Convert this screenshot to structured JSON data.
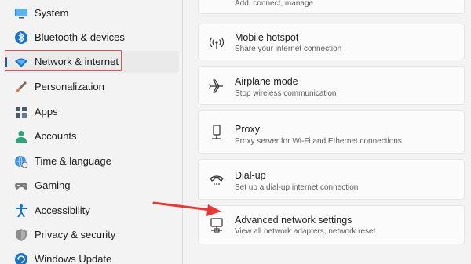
{
  "sidebar": {
    "items": [
      {
        "label": "System",
        "icon": "monitor-icon"
      },
      {
        "label": "Bluetooth & devices",
        "icon": "bluetooth-icon"
      },
      {
        "label": "Network & internet",
        "icon": "wifi-icon",
        "selected": true
      },
      {
        "label": "Personalization",
        "icon": "paintbrush-icon"
      },
      {
        "label": "Apps",
        "icon": "apps-icon"
      },
      {
        "label": "Accounts",
        "icon": "person-icon"
      },
      {
        "label": "Time & language",
        "icon": "globe-clock-icon"
      },
      {
        "label": "Gaming",
        "icon": "gamepad-icon"
      },
      {
        "label": "Accessibility",
        "icon": "accessibility-icon"
      },
      {
        "label": "Privacy & security",
        "icon": "shield-icon"
      },
      {
        "label": "Windows Update",
        "icon": "refresh-icon"
      }
    ]
  },
  "main": {
    "top_partial_desc": "Add, connect, manage",
    "cards": [
      {
        "title": "Mobile hotspot",
        "desc": "Share your internet connection",
        "icon": "hotspot-icon"
      },
      {
        "title": "Airplane mode",
        "desc": "Stop wireless communication",
        "icon": "airplane-icon"
      },
      {
        "title": "Proxy",
        "desc": "Proxy server for Wi-Fi and Ethernet connections",
        "icon": "proxy-icon"
      },
      {
        "title": "Dial-up",
        "desc": "Set up a dial-up internet connection",
        "icon": "dialup-icon"
      },
      {
        "title": "Advanced network settings",
        "desc": "View all network adapters, network reset",
        "icon": "network-adapter-icon"
      }
    ]
  },
  "colors": {
    "accent": "#0067c0",
    "highlight": "#d9534f",
    "arrow": "#e53935"
  }
}
